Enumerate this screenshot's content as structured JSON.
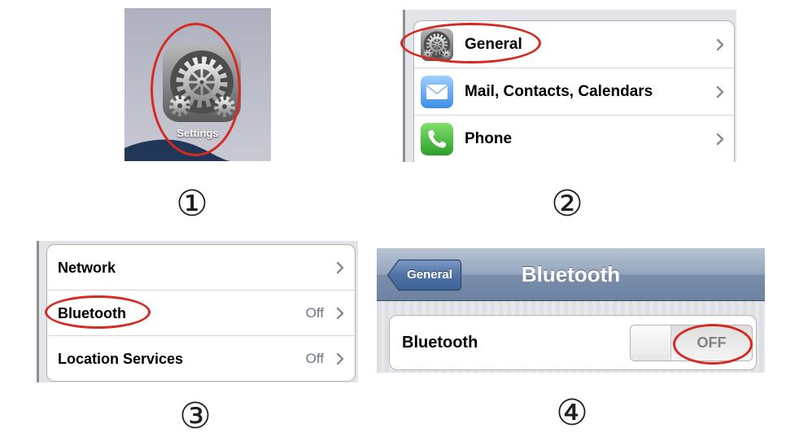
{
  "colors": {
    "highlight": "#d42a22",
    "nav_bar": "#7489a6",
    "back_button": "#4f73a7",
    "detail_text": "#6a7390"
  },
  "steps": [
    "①",
    "②",
    "③",
    "④"
  ],
  "panel1": {
    "icon": "settings-gear-icon",
    "label": "Settings"
  },
  "panel2": {
    "rows": [
      {
        "icon": "gear-icon",
        "label": "General",
        "chevron": "chevron-right-icon"
      },
      {
        "icon": "mail-icon",
        "label": "Mail, Contacts, Calendars",
        "chevron": "chevron-right-icon"
      },
      {
        "icon": "phone-icon",
        "label": "Phone",
        "chevron": "chevron-right-icon"
      }
    ]
  },
  "panel3": {
    "rows": [
      {
        "label": "Network",
        "chevron": "chevron-right-icon"
      },
      {
        "label": "Bluetooth",
        "value": "Off",
        "chevron": "chevron-right-icon"
      },
      {
        "label": "Location Services",
        "value": "Off",
        "chevron": "chevron-right-icon"
      }
    ]
  },
  "panel4": {
    "back_button": "General",
    "title": "Bluetooth",
    "row_label": "Bluetooth",
    "toggle_state": "OFF"
  }
}
